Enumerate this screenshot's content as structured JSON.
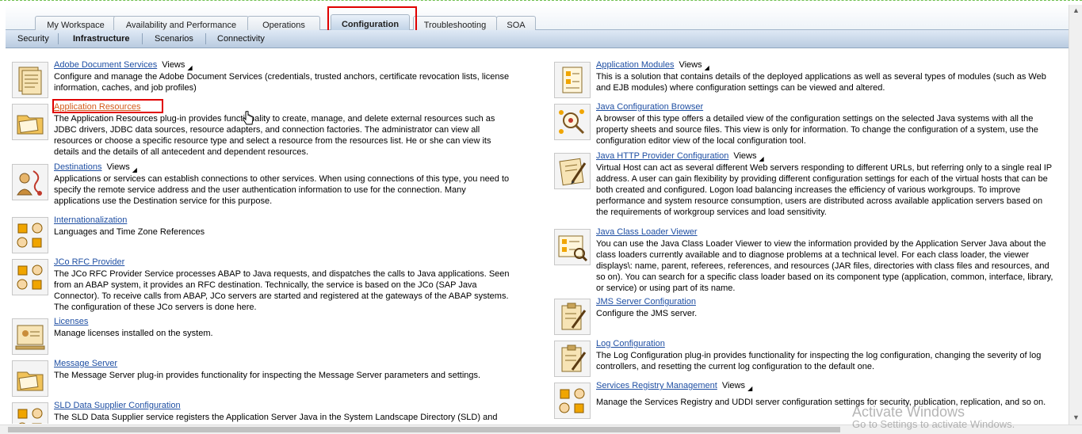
{
  "top_tabs": [
    "My Workspace",
    "Availability and Performance",
    "Operations",
    "Configuration",
    "Troubleshooting",
    "SOA"
  ],
  "active_tab": "Configuration",
  "sub_tabs": [
    "Security",
    "Infrastructure",
    "Scenarios",
    "Connectivity"
  ],
  "active_sub_tab": "Infrastructure",
  "views_label": "Views",
  "left_items": [
    {
      "title": "Adobe Document Services",
      "views": true,
      "lines": [
        "Configure and manage the Adobe Document Services (credentials, trusted anchors, certificate revocation lists, license",
        "information, caches, and job profiles)"
      ]
    },
    {
      "title": "Application Resources",
      "views": false,
      "lines": [
        "The Application Resources plug-in provides functionality to create, manage, and delete external resources such as",
        "JDBC drivers, JDBC data sources, resource adapters, and connection factories. The administrator can view all",
        "resources or choose a specific resource type and select a resource from the resources list. He or she can view its",
        "details and the details of all antecedent and dependent resources."
      ]
    },
    {
      "title": "Destinations",
      "views": true,
      "lines": [
        "Applications or services can establish connections to other services. When using connections of this type, you need to",
        "specify the remote service address and the user authentication information to use for the connection. Many",
        "applications use the Destination service for this purpose."
      ]
    },
    {
      "title": "Internationalization",
      "views": false,
      "lines": [
        "Languages and Time Zone References"
      ]
    },
    {
      "title": "JCo RFC Provider",
      "views": false,
      "lines": [
        "The JCo RFC Provider Service processes ABAP to Java requests, and dispatches the calls to Java applications. Seen",
        "from an ABAP system, it provides an RFC destination. Technically, the service is based on the JCo (SAP Java",
        "Connector). To receive calls from ABAP, JCo servers are started and registered at the gateways of the ABAP systems.",
        "The configuration of these JCo servers is done here."
      ]
    },
    {
      "title": "Licenses",
      "views": false,
      "lines": [
        "Manage licenses installed on the system."
      ]
    },
    {
      "title": "Message Server",
      "views": false,
      "lines": [
        "The Message Server plug-in provides functionality for inspecting the Message Server parameters and settings."
      ]
    },
    {
      "title": "SLD Data Supplier Configuration",
      "views": false,
      "lines": [
        "The SLD Data Supplier service registers the Application Server Java in the System Landscape Directory (SLD) and"
      ]
    }
  ],
  "right_items": [
    {
      "title": "Application Modules",
      "views": true,
      "lines": [
        "This is a solution that contains details of the deployed applications as well as several types of modules (such as Web",
        "and EJB modules) where configuration settings can be viewed and altered."
      ]
    },
    {
      "title": "Java Configuration Browser",
      "views": false,
      "lines": [
        "A browser of this type offers a detailed view of the configuration settings on the selected Java systems with all the",
        "property sheets and source files. This view is only for information. To change the configuration of a system, use the",
        "configuration editor view of the local configuration tool."
      ]
    },
    {
      "title": "Java HTTP Provider Configuration",
      "views": true,
      "lines": [
        "Virtual Host can act as several different Web servers responding to different URLs, but referring only to a single real IP",
        "address. A user can gain flexibility by providing different configuration settings for each of the virtual hosts that can be",
        "both created and configured. Logon load balancing increases the efficiency of various workgroups. To improve",
        "performance and system resource consumption, users are distributed across available application servers based on",
        "the requirements of workgroup services and load sensitivity."
      ]
    },
    {
      "title": "Java Class Loader Viewer",
      "views": false,
      "lines": [
        "You can use the Java Class Loader Viewer to view the information provided by the Application Server Java about the",
        "class loaders currently available and to diagnose problems at a technical level. For each class loader, the viewer",
        "displays\\: name, parent, referees, references, and resources (JAR files, directories with class files and resources, and",
        "so on). You can search for a specific class loader based on its component type (application, common, interface, library,",
        "or service) or using part of its name."
      ]
    },
    {
      "title": "JMS Server Configuration",
      "views": false,
      "lines": [
        "Configure the JMS server."
      ]
    },
    {
      "title": "Log Configuration",
      "views": false,
      "lines": [
        "The Log Configuration plug-in provides functionality for inspecting the log configuration, changing the severity of log",
        "controllers, and resetting the current log configuration to the default one."
      ]
    },
    {
      "title": "Services Registry Management",
      "views": true,
      "lines": [
        "Manage the Services Registry and UDDI server configuration settings for security, publication, replication, and so on."
      ]
    }
  ],
  "watermark": {
    "line1": "Activate Windows",
    "line2": "Go to Settings to activate Windows."
  }
}
